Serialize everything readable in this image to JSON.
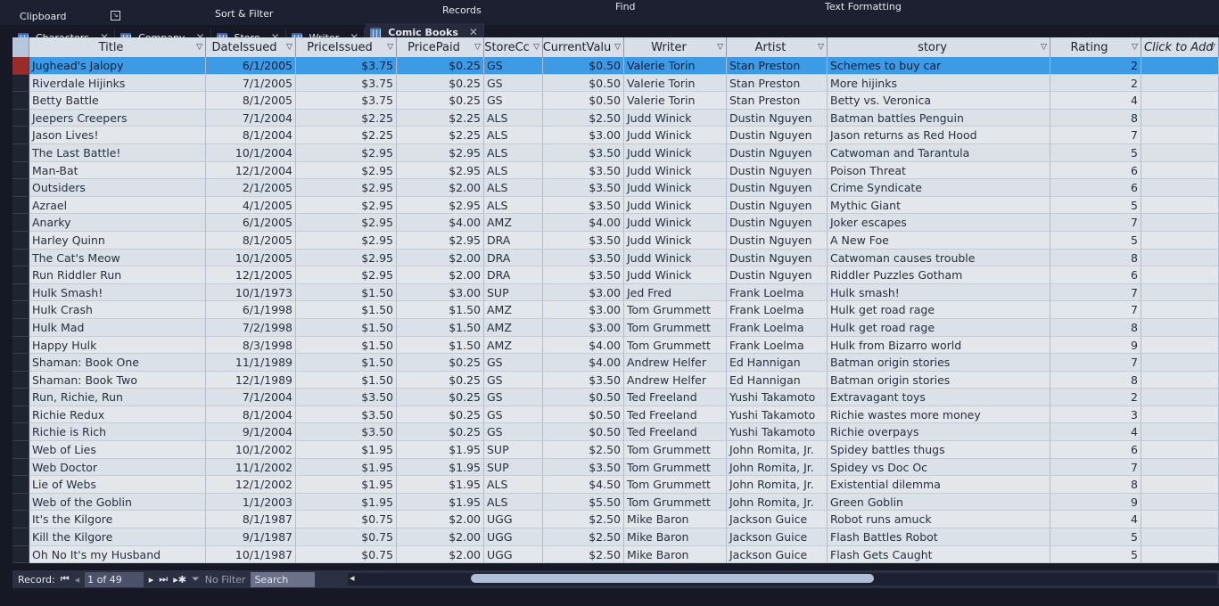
{
  "ribbon": {
    "groups": [
      "Clipboard",
      "Sort & Filter",
      "Records",
      "Find",
      "Text Formatting"
    ]
  },
  "tabs": [
    {
      "label": "Characters",
      "active": false
    },
    {
      "label": "Company",
      "active": false
    },
    {
      "label": "Store",
      "active": false
    },
    {
      "label": "Writer",
      "active": false
    },
    {
      "label": "Comic Books",
      "active": true
    }
  ],
  "columns": [
    "Title",
    "DateIssued",
    "PriceIssued",
    "PricePaid",
    "StoreCc",
    "CurrentValu",
    "Writer",
    "Artist",
    "story",
    "Rating",
    "Click to Add"
  ],
  "rows": [
    [
      "Jughead's Jalopy",
      "6/1/2005",
      "$3.75",
      "$0.25",
      "GS",
      "$0.50",
      "Valerie Torin",
      "Stan Preston",
      "Schemes to buy car",
      "2"
    ],
    [
      "Riverdale Hijinks",
      "7/1/2005",
      "$3.75",
      "$0.25",
      "GS",
      "$0.50",
      "Valerie Torin",
      "Stan Preston",
      "More hijinks",
      "2"
    ],
    [
      "Betty Battle",
      "8/1/2005",
      "$3.75",
      "$0.25",
      "GS",
      "$0.50",
      "Valerie Torin",
      "Stan Preston",
      "Betty vs. Veronica",
      "4"
    ],
    [
      "Jeepers Creepers",
      "7/1/2004",
      "$2.25",
      "$2.25",
      "ALS",
      "$2.50",
      "Judd Winick",
      "Dustin Nguyen",
      "Batman battles Penguin",
      "8"
    ],
    [
      "Jason Lives!",
      "8/1/2004",
      "$2.25",
      "$2.25",
      "ALS",
      "$3.00",
      "Judd Winick",
      "Dustin Nguyen",
      "Jason returns as Red Hood",
      "7"
    ],
    [
      "The Last Battle!",
      "10/1/2004",
      "$2.95",
      "$2.95",
      "ALS",
      "$3.50",
      "Judd Winick",
      "Dustin Nguyen",
      "Catwoman and Tarantula",
      "5"
    ],
    [
      "Man-Bat",
      "12/1/2004",
      "$2.95",
      "$2.95",
      "ALS",
      "$3.50",
      "Judd Winick",
      "Dustin Nguyen",
      "Poison Threat",
      "6"
    ],
    [
      "Outsiders",
      "2/1/2005",
      "$2.95",
      "$2.00",
      "ALS",
      "$3.50",
      "Judd Winick",
      "Dustin Nguyen",
      "Crime Syndicate",
      "6"
    ],
    [
      "Azrael",
      "4/1/2005",
      "$2.95",
      "$2.95",
      "ALS",
      "$3.50",
      "Judd Winick",
      "Dustin Nguyen",
      "Mythic Giant",
      "5"
    ],
    [
      "Anarky",
      "6/1/2005",
      "$2.95",
      "$4.00",
      "AMZ",
      "$4.00",
      "Judd Winick",
      "Dustin Nguyen",
      "Joker escapes",
      "7"
    ],
    [
      "Harley Quinn",
      "8/1/2005",
      "$2.95",
      "$2.95",
      "DRA",
      "$3.50",
      "Judd Winick",
      "Dustin Nguyen",
      "A New Foe",
      "5"
    ],
    [
      "The Cat's Meow",
      "10/1/2005",
      "$2.95",
      "$2.00",
      "DRA",
      "$3.50",
      "Judd Winick",
      "Dustin Nguyen",
      "Catwoman causes trouble",
      "8"
    ],
    [
      "Run Riddler Run",
      "12/1/2005",
      "$2.95",
      "$2.00",
      "DRA",
      "$3.50",
      "Judd Winick",
      "Dustin Nguyen",
      "Riddler Puzzles Gotham",
      "6"
    ],
    [
      "Hulk Smash!",
      "10/1/1973",
      "$1.50",
      "$3.00",
      "SUP",
      "$3.00",
      "Jed Fred",
      "Frank Loelma",
      "Hulk smash!",
      "7"
    ],
    [
      "Hulk Crash",
      "6/1/1998",
      "$1.50",
      "$1.50",
      "AMZ",
      "$3.00",
      "Tom Grummett",
      "Frank Loelma",
      "Hulk get road rage",
      "7"
    ],
    [
      "Hulk Mad",
      "7/2/1998",
      "$1.50",
      "$1.50",
      "AMZ",
      "$3.00",
      "Tom Grummett",
      "Frank Loelma",
      "Hulk get road rage",
      "8"
    ],
    [
      "Happy Hulk",
      "8/3/1998",
      "$1.50",
      "$1.50",
      "AMZ",
      "$4.00",
      "Tom Grummett",
      "Frank Loelma",
      "Hulk from Bizarro world",
      "9"
    ],
    [
      "Shaman: Book One",
      "11/1/1989",
      "$1.50",
      "$0.25",
      "GS",
      "$4.00",
      "Andrew Helfer",
      "Ed Hannigan",
      "Batman origin stories",
      "7"
    ],
    [
      "Shaman: Book Two",
      "12/1/1989",
      "$1.50",
      "$0.25",
      "GS",
      "$3.50",
      "Andrew Helfer",
      "Ed Hannigan",
      "Batman origin stories",
      "8"
    ],
    [
      "Run, Richie, Run",
      "7/1/2004",
      "$3.50",
      "$0.25",
      "GS",
      "$0.50",
      "Ted Freeland",
      "Yushi Takamoto",
      "Extravagant toys",
      "2"
    ],
    [
      "Richie Redux",
      "8/1/2004",
      "$3.50",
      "$0.25",
      "GS",
      "$0.50",
      "Ted Freeland",
      "Yushi Takamoto",
      "Richie wastes more money",
      "3"
    ],
    [
      "Richie is Rich",
      "9/1/2004",
      "$3.50",
      "$0.25",
      "GS",
      "$0.50",
      "Ted Freeland",
      "Yushi Takamoto",
      "Richie overpays",
      "4"
    ],
    [
      "Web of Lies",
      "10/1/2002",
      "$1.95",
      "$1.95",
      "SUP",
      "$2.50",
      "Tom Grummett",
      "John Romita, Jr.",
      "Spidey battles thugs",
      "6"
    ],
    [
      "Web Doctor",
      "11/1/2002",
      "$1.95",
      "$1.95",
      "SUP",
      "$3.50",
      "Tom Grummett",
      "John Romita, Jr.",
      "Spidey vs Doc Oc",
      "7"
    ],
    [
      "Lie of Webs",
      "12/1/2002",
      "$1.95",
      "$1.95",
      "ALS",
      "$4.50",
      "Tom Grummett",
      "John Romita, Jr.",
      "Existential dilemma",
      "8"
    ],
    [
      "Web of the Goblin",
      "1/1/2003",
      "$1.95",
      "$1.95",
      "ALS",
      "$5.50",
      "Tom Grummett",
      "John Romita, Jr.",
      "Green Goblin",
      "9"
    ],
    [
      "It's the Kilgore",
      "8/1/1987",
      "$0.75",
      "$2.00",
      "UGG",
      "$2.50",
      "Mike Baron",
      "Jackson Guice",
      "Robot runs amuck",
      "4"
    ],
    [
      "Kill the Kilgore",
      "9/1/1987",
      "$0.75",
      "$2.00",
      "UGG",
      "$2.50",
      "Mike Baron",
      "Jackson Guice",
      "Flash Battles Robot",
      "5"
    ],
    [
      "Oh No It's my Husband",
      "10/1/1987",
      "$0.75",
      "$2.00",
      "UGG",
      "$2.50",
      "Mike Baron",
      "Jackson Guice",
      "Flash Gets Caught",
      "5"
    ]
  ],
  "status": {
    "record_label": "Record:",
    "position": "1 of 49",
    "filter": "No Filter",
    "search_placeholder": "Search"
  },
  "colors": {
    "selected_row": "#3d9be6",
    "header": "#d9dfe8",
    "background": "#161925"
  }
}
